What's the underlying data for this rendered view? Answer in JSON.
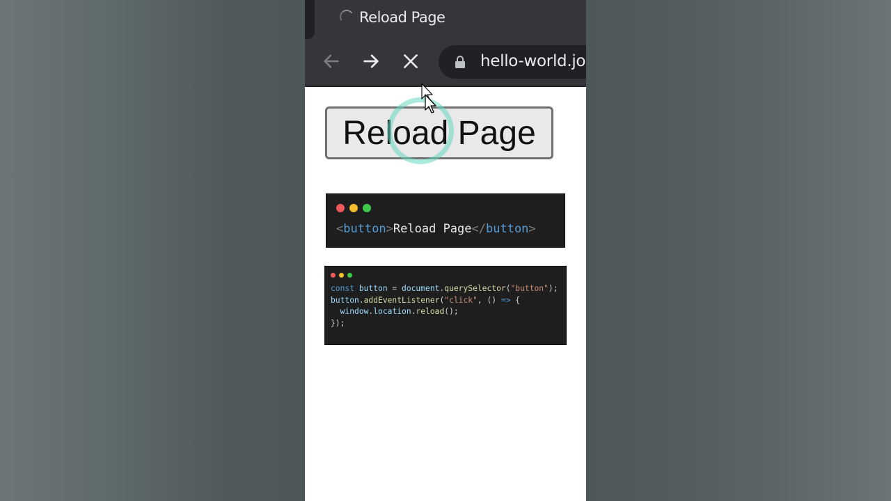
{
  "browser": {
    "tab": {
      "title": "Reload Page",
      "loading": true
    },
    "nav": {
      "back_icon": "arrow-left-icon",
      "forward_icon": "arrow-right-icon",
      "stop_icon": "close-icon"
    },
    "omnibox": {
      "lock_icon": "lock-icon",
      "url": "hello-world.jo"
    }
  },
  "page": {
    "button_label": "Reload Page"
  },
  "snippets": {
    "html": {
      "open_lt": "<",
      "open_tag": "button",
      "open_gt": ">",
      "text": "Reload Page",
      "close_lt": "</",
      "close_tag": "button",
      "close_gt": ">"
    },
    "js": {
      "l1": {
        "kw": "const",
        "var": " button",
        "eq": " = ",
        "obj": "document",
        "dot": ".",
        "fn": "querySelector",
        "p1": "(",
        "str": "\"button\"",
        "p2": ");"
      },
      "l2": {
        "var": "button",
        "dot": ".",
        "fn": "addEventListener",
        "p1": "(",
        "str": "\"click\"",
        "mid": ", () ",
        "arrow": "=>",
        "brace": " {"
      },
      "l3": {
        "indent": "  ",
        "obj": "window",
        "dot1": ".",
        "prop": "location",
        "dot2": ".",
        "fn": "reload",
        "end": "();"
      },
      "l4": {
        "end": "});"
      }
    }
  },
  "colors": {
    "chrome_dark": "#35363a",
    "omnibox_bg": "#202124",
    "code_bg": "#1e1e1e",
    "click_ring": "#64d7be",
    "traffic_red": "#ee5a5a",
    "traffic_yellow": "#f5bd2e",
    "traffic_green": "#3ec94a"
  }
}
